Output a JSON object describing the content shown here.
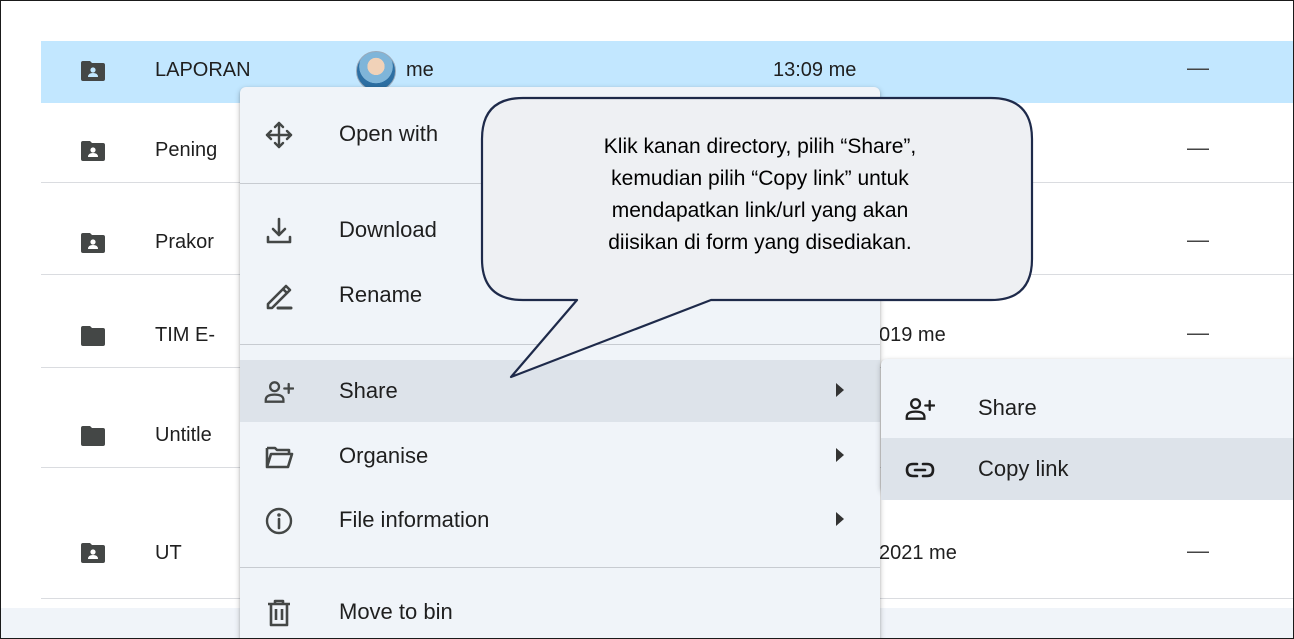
{
  "files": [
    {
      "name": "LAPORAN",
      "owner": "me",
      "modified": "13:09 me",
      "size": "—",
      "shared": true,
      "selected": true
    },
    {
      "name": "Pening",
      "owner": "",
      "modified": "",
      "size": "—",
      "shared": true
    },
    {
      "name": "Prakor",
      "owner": "",
      "modified": "",
      "size": "—",
      "shared": true
    },
    {
      "name": "TIM E-",
      "owner": "",
      "modified": "019 me",
      "size": "—",
      "shared": false
    },
    {
      "name": "Untitle",
      "owner": "",
      "modified": "",
      "size": "",
      "shared": false
    },
    {
      "name": "UT",
      "owner": "",
      "modified": "2021 me",
      "size": "—",
      "shared": true
    }
  ],
  "context_menu": {
    "open_with": "Open with",
    "download": "Download",
    "rename": "Rename",
    "share": "Share",
    "organise": "Organise",
    "file_information": "File information",
    "move_to_bin": "Move to bin"
  },
  "share_submenu": {
    "share": "Share",
    "copy_link": "Copy link"
  },
  "callout": {
    "lines": [
      "Klik kanan directory, pilih “Share”,",
      "kemudian pilih “Copy link” untuk",
      "mendapatkan link/url yang akan",
      "diisikan di form yang disediakan."
    ]
  },
  "colors": {
    "selected_row": "#c2e7ff",
    "menu_background": "#f0f4f9",
    "menu_hover": "#dde3ea",
    "icon": "#444746"
  }
}
